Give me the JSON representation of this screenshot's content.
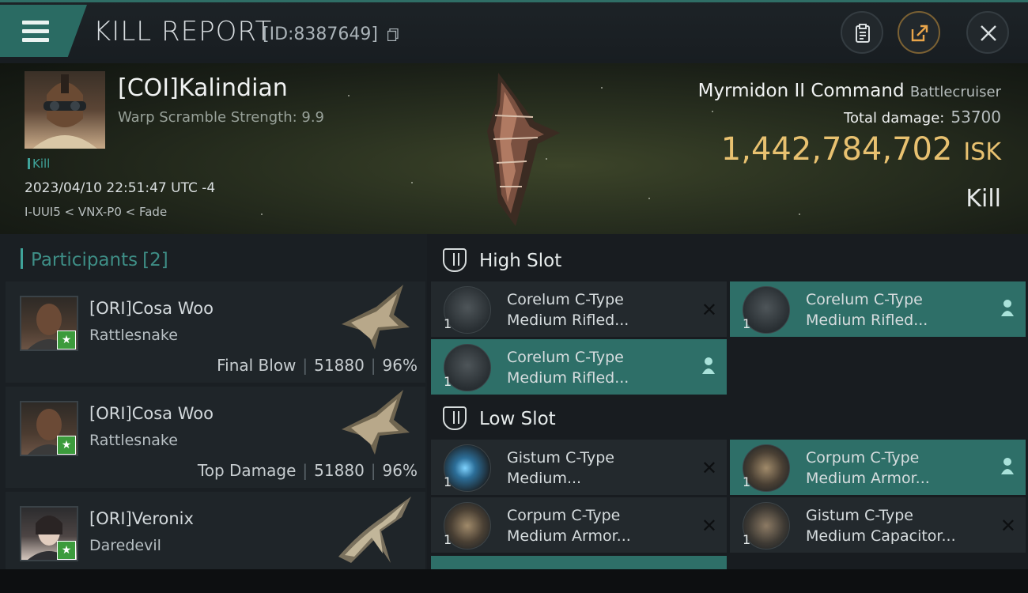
{
  "header": {
    "title": "KILL REPORT",
    "id_text": "[ID:8387649]",
    "icons": [
      "menu-icon",
      "copy-icon",
      "clipboard-icon",
      "share-icon",
      "close-icon"
    ]
  },
  "victim": {
    "name": "[COI]Kalindian",
    "warp_scramble": "Warp Scramble Strength: 9.9",
    "tag": "Kill",
    "datetime": "2023/04/10 22:51:47 UTC -4",
    "route": "I-UUI5 < VNX-P0 < Fade",
    "ship_name": "Myrmidon II Command",
    "ship_class": "Battlecruiser",
    "total_damage_label": "Total damage:",
    "total_damage": "53700",
    "isk_value": "1,442,784,702",
    "isk_unit": "ISK",
    "type": "Kill"
  },
  "participants": {
    "heading": "Participants",
    "count": "[2]",
    "items": [
      {
        "name": "[ORI]Cosa Woo",
        "ship": "Rattlesnake",
        "role": "Final Blow",
        "damage": "51880",
        "percent": "96%"
      },
      {
        "name": "[ORI]Cosa Woo",
        "ship": "Rattlesnake",
        "role": "Top Damage",
        "damage": "51880",
        "percent": "96%"
      },
      {
        "name": "[ORI]Veronix",
        "ship": "Daredevil",
        "role": "",
        "damage": "",
        "percent": ""
      }
    ]
  },
  "slots": {
    "high": {
      "title": "High Slot",
      "modules": [
        {
          "line1": "Corelum C-Type",
          "line2": "Medium Rifled...",
          "qty": "1",
          "state": "destroyed"
        },
        {
          "line1": "Corelum C-Type",
          "line2": "Medium Rifled...",
          "qty": "1",
          "state": "dropped"
        },
        {
          "line1": "Corelum C-Type",
          "line2": "Medium Rifled...",
          "qty": "1",
          "state": "dropped"
        }
      ]
    },
    "low": {
      "title": "Low Slot",
      "modules": [
        {
          "line1": "Gistum C-Type",
          "line2": "Medium...",
          "qty": "1",
          "state": "destroyed"
        },
        {
          "line1": "Corpum C-Type",
          "line2": "Medium Armor...",
          "qty": "1",
          "state": "dropped"
        },
        {
          "line1": "Corpum C-Type",
          "line2": "Medium Armor...",
          "qty": "1",
          "state": "destroyed"
        },
        {
          "line1": "Gistum C-Type",
          "line2": "Medium Capacitor...",
          "qty": "1",
          "state": "destroyed"
        }
      ]
    }
  },
  "colors": {
    "accent": "#2e6f68",
    "isk": "#e8c170",
    "badge": "#3c9b3c"
  }
}
